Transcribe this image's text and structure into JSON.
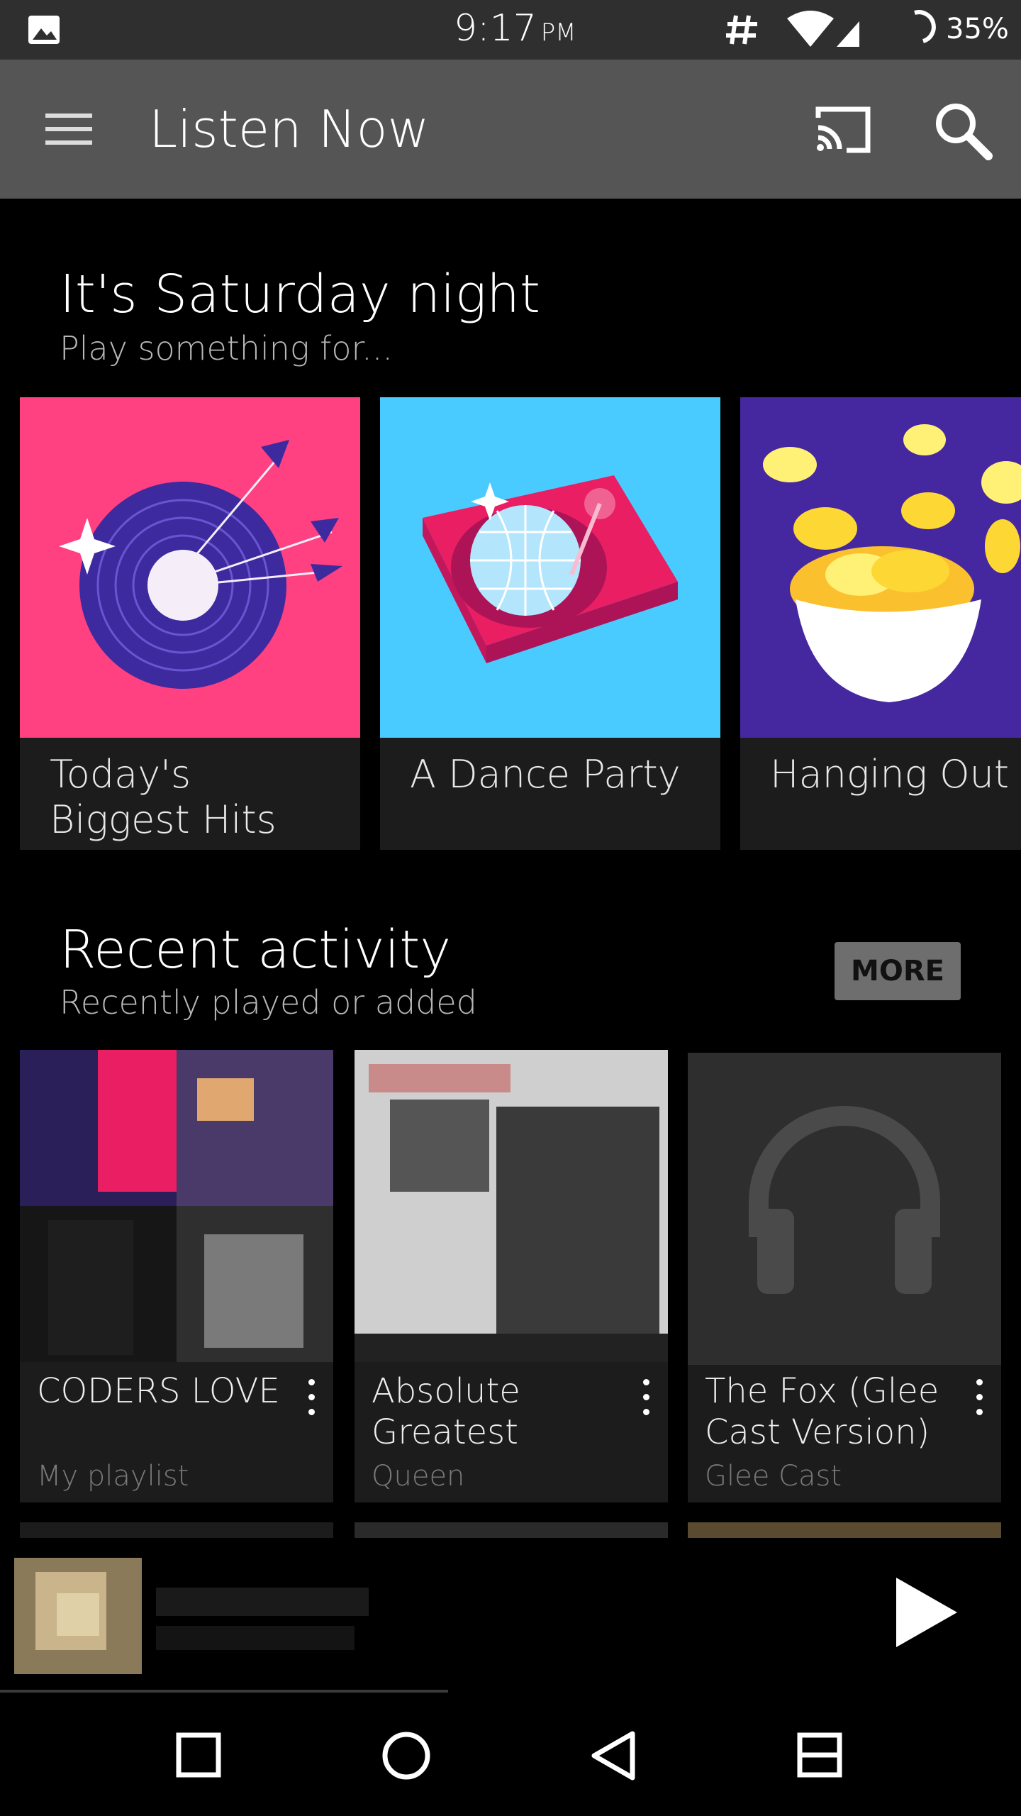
{
  "status_bar": {
    "time": "9:17",
    "ampm": "PM",
    "battery": "35%",
    "icons": [
      "image-icon",
      "hashtag-icon",
      "wifi-icon",
      "signal-icon",
      "battery-icon"
    ]
  },
  "app_bar": {
    "title": "Listen Now",
    "icons": [
      "menu-icon",
      "cast-icon",
      "search-icon"
    ]
  },
  "saturday": {
    "title": "It's Saturday night",
    "subtitle": "Play something for...",
    "cards": [
      {
        "label_line1": "Today's",
        "label_line2": "Biggest Hits",
        "bg": "#ff4081"
      },
      {
        "label_line1": "A Dance Party",
        "label_line2": "",
        "bg": "#4acbff"
      },
      {
        "label_line1": "Hanging Out",
        "label_line2": "",
        "bg": "#4527a0"
      }
    ]
  },
  "recent": {
    "title": "Recent activity",
    "subtitle": "Recently played or added",
    "more_label": "MORE",
    "items": [
      {
        "title": "CODERS LOVE",
        "subtitle": "My playlist"
      },
      {
        "title": "Absolute Greatest",
        "subtitle": "Queen"
      },
      {
        "title": "The Fox (Glee Cast Version)",
        "subtitle": "Glee Cast"
      }
    ]
  },
  "colors": {
    "app_bar": "#555555",
    "status_bar": "#2f2f2f",
    "card_bg": "#1c1c1c",
    "more_button": "#6e6e6e"
  }
}
